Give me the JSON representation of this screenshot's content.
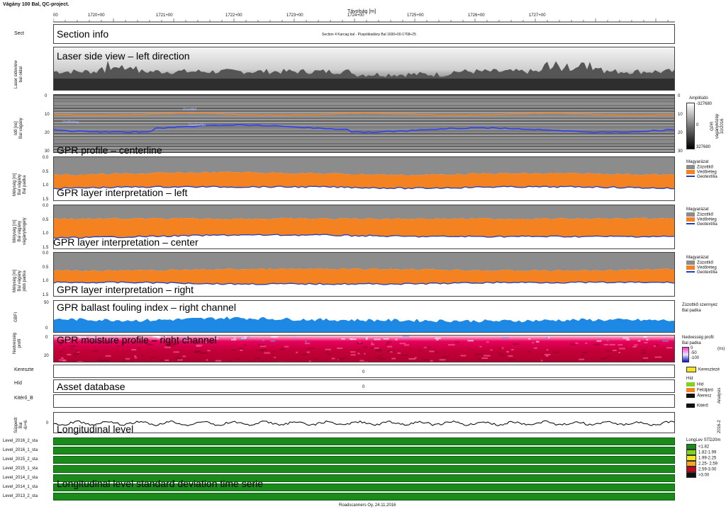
{
  "header": {
    "title": "Vágány 100 Bal, QC-project.",
    "axis_title": "Távolság [m]",
    "stations": [
      "00",
      "1720+00",
      "1721+00",
      "1722+00",
      "1723+00",
      "1724+00",
      "1725+00",
      "1726+00",
      "1727+00"
    ]
  },
  "footer": "Roadscanners Oy, 24.11.2016",
  "right_edge": {
    "analysis": "Analysis",
    "year": "2016-2"
  },
  "sect": {
    "label": "Sect",
    "caption": "Section info",
    "info_text": "Section 4 Karcag bal - Püspökladány Bal 1690+00-1768+25"
  },
  "laser": {
    "ylabel": "Laser sideview\nbal oldal",
    "caption": "Laser side view – left direction"
  },
  "gpr_profile": {
    "ylabel": "Idő [ns]\nBal vágány",
    "caption": "GPR profile – centerline",
    "ticks_left": [
      "0",
      "10",
      "20",
      "30"
    ],
    "ticks_right": [
      "0",
      "10",
      "20",
      "30"
    ],
    "annot1": "Zúzottkő",
    "annot2": "Védőréteg",
    "annot3": "Geotextília",
    "colorbar_title": "Amplitúdó",
    "colorbar_max": "-327680",
    "colorbar_mid": "0",
    "colorbar_min": "327680",
    "side_label": "GPR\nvágányközép\n10/2016"
  },
  "layer_left": {
    "ylabel": "Mélység [m]\nBal vágány\nBal padka",
    "caption": "GPR layer interpretation – left",
    "ticks": [
      "0.0",
      "0.5",
      "1.0",
      "1.5"
    ]
  },
  "layer_center": {
    "ylabel": "Mélység [m]\nBal vágány\nvágánytengely",
    "caption": "GPR layer interpretation – center",
    "ticks": [
      "0.0",
      "0.5",
      "1.0",
      "1.5"
    ]
  },
  "layer_right": {
    "ylabel": "Mélység [m]\nBal vágány\njobb padka",
    "caption": "GPR layer interpretation – right",
    "ticks": [
      "0.0",
      "0.5",
      "1.0",
      "1.5"
    ]
  },
  "layer_legend": {
    "title": "Magyarázat",
    "items": [
      "Zúzottkő",
      "Védőréteg",
      "Geotextília"
    ],
    "colors": [
      "#8c8c8c",
      "#f58220",
      "#1f3fbf"
    ]
  },
  "gbfi": {
    "ylabel": "GBFI",
    "caption": "GPR ballast fouling index – right channel",
    "ticks": [
      "50",
      "0"
    ],
    "legend_title": "Zúzottkő szennyez",
    "legend_sub": "Bal padka"
  },
  "moisture": {
    "ylabel": "Nedvesség\nprofil",
    "caption": "GPR moisture profile – right channel",
    "ticks": [
      "0",
      "20"
    ],
    "legend_title": "Nedvesség profil",
    "legend_sub": "Bal padka",
    "legend_vals": [
      "0",
      "-50",
      "-100"
    ],
    "unit": "(ns)"
  },
  "assets": {
    "caption": "Asset database",
    "rows": [
      "Kereszte",
      "Híd",
      "Kitérő_B"
    ],
    "values": [
      "0",
      "0",
      ""
    ],
    "legend": {
      "kereszt": "Keresztezé",
      "hid_title": "Híd",
      "items": [
        "Híd",
        "Felüljáró",
        "Áteresz"
      ],
      "kitero": "Kitérő"
    }
  },
  "longlevel": {
    "ylabel": "Süppedt\nBal\n-6/+6",
    "caption": "Longitudinal level",
    "tick": "0"
  },
  "levels": {
    "caption": "Longitudinal level standard deviation time serie",
    "rows": [
      "Level_2016_2_sta",
      "Level_2016_1_sta",
      "Level_2015_2_sta",
      "Level_2015_1_sta",
      "Level_2014_2_sta",
      "Level_2014_1_sta",
      "Level_2013_2_sta"
    ],
    "legend_title": "LongLev STD20m",
    "legend_items": [
      "<1.82",
      "1.82-1.99",
      "1.99-2.25",
      "2.25- 2.59",
      "2.59-3.00",
      ">3.00"
    ],
    "legend_colors": [
      "#1a8a1a",
      "#7ed321",
      "#f5e625",
      "#f5a623",
      "#d0021b",
      "#111111"
    ]
  },
  "chart_data": [
    {
      "type": "area",
      "title": "GPR layer interpretation – left",
      "ylabel": "Mélység [m]",
      "ylim": [
        0,
        1.5
      ],
      "x": [
        "1720+00",
        "1721+00",
        "1722+00",
        "1723+00",
        "1724+00",
        "1725+00",
        "1726+00",
        "1727+00"
      ],
      "series": [
        {
          "name": "Zúzottkő",
          "values": [
            0.6,
            0.55,
            0.5,
            0.55,
            0.6,
            0.55,
            0.55,
            0.6
          ]
        },
        {
          "name": "Védőréteg",
          "values": [
            1.05,
            1.0,
            1.0,
            1.0,
            1.05,
            1.0,
            1.0,
            1.05
          ]
        }
      ]
    },
    {
      "type": "area",
      "title": "GPR layer interpretation – center",
      "ylabel": "Mélység [m]",
      "ylim": [
        0,
        1.5
      ],
      "x": [
        "1720+00",
        "1721+00",
        "1722+00",
        "1723+00",
        "1724+00",
        "1725+00",
        "1726+00",
        "1727+00"
      ],
      "series": [
        {
          "name": "Zúzottkő",
          "values": [
            0.45,
            0.45,
            0.45,
            0.45,
            0.45,
            0.45,
            0.45,
            0.45
          ]
        },
        {
          "name": "Védőréteg",
          "values": [
            1.1,
            1.05,
            1.0,
            1.0,
            1.05,
            1.05,
            1.05,
            1.05
          ]
        }
      ]
    },
    {
      "type": "area",
      "title": "GPR layer interpretation – right",
      "ylabel": "Mélység [m]",
      "ylim": [
        0,
        1.5
      ],
      "x": [
        "1720+00",
        "1721+00",
        "1722+00",
        "1723+00",
        "1724+00",
        "1725+00",
        "1726+00",
        "1727+00"
      ],
      "series": [
        {
          "name": "Zúzottkő",
          "values": [
            0.6,
            0.6,
            0.55,
            0.55,
            0.55,
            0.6,
            0.6,
            0.55
          ]
        },
        {
          "name": "Védőréteg",
          "values": [
            1.0,
            1.0,
            1.05,
            1.05,
            1.05,
            1.0,
            1.0,
            1.0
          ]
        }
      ]
    },
    {
      "type": "area",
      "title": "GPR ballast fouling index – right channel",
      "ylabel": "GBFI",
      "ylim": [
        0,
        50
      ],
      "x": [
        "1720+00",
        "1721+00",
        "1722+00",
        "1723+00",
        "1724+00",
        "1725+00",
        "1726+00",
        "1727+00"
      ],
      "series": [
        {
          "name": "Bal padka",
          "values": [
            22,
            20,
            24,
            21,
            20,
            19,
            21,
            20
          ]
        }
      ]
    }
  ]
}
